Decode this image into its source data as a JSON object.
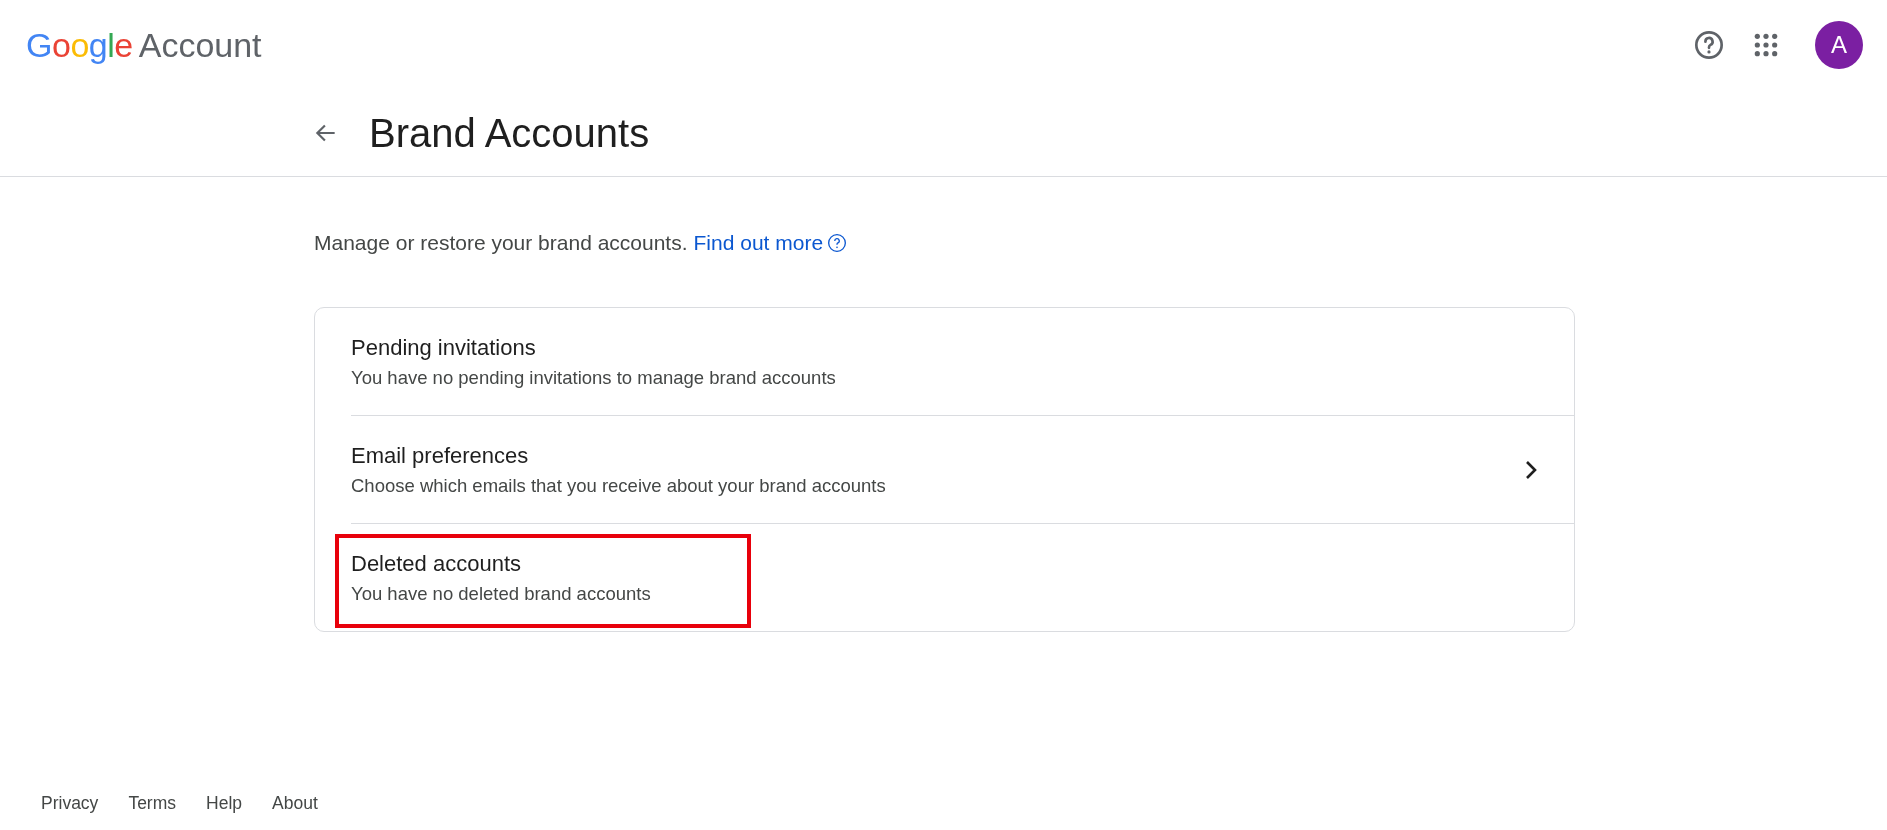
{
  "header": {
    "logo": "Google",
    "product": "Account",
    "avatar_letter": "A"
  },
  "page": {
    "title": "Brand Accounts"
  },
  "intro": {
    "text": "Manage or restore your brand accounts.",
    "link": "Find out more"
  },
  "items": [
    {
      "title": "Pending invitations",
      "subtitle": "You have no pending invitations to manage brand accounts",
      "has_chevron": false,
      "highlighted": false
    },
    {
      "title": "Email preferences",
      "subtitle": "Choose which emails that you receive about your brand accounts",
      "has_chevron": true,
      "highlighted": false
    },
    {
      "title": "Deleted accounts",
      "subtitle": "You have no deleted brand accounts",
      "has_chevron": false,
      "highlighted": true
    }
  ],
  "footer": [
    "Privacy",
    "Terms",
    "Help",
    "About"
  ]
}
